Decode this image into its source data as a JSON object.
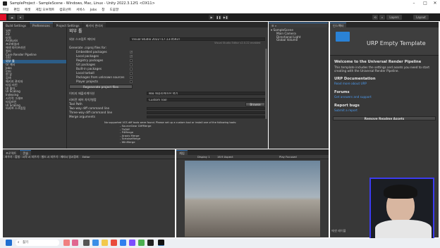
{
  "window": {
    "title": "SampleProject - SampleScene - Windows, Mac, Linux - Unity 2022.3.12f1 <DX11>",
    "controls": [
      "–",
      "□",
      "✕"
    ]
  },
  "menu": [
    "파일",
    "편집",
    "에셋",
    "게임 오브젝트",
    "컴포넌트",
    "서비스",
    "Jobs",
    "창",
    "도움말"
  ],
  "toolbar": {
    "layers_label": "Layers",
    "layout_label": "Layout"
  },
  "left_tabs": [
    "Build Settings",
    "Preferences",
    "Project Settings",
    "패키지 관리자"
  ],
  "sidebar": {
    "items": [
      {
        "label": "일반",
        "selected": false
      },
      {
        "label": "2D",
        "selected": false
      },
      {
        "label": "  타일",
        "selected": false
      },
      {
        "label": "Analysis",
        "selected": false
      },
      {
        "label": "  프로파일러",
        "selected": false
      },
      {
        "label": "에셋 파이프라인",
        "selected": false
      },
      {
        "label": "컬러",
        "selected": false
      },
      {
        "label": "Core Render Pipeline",
        "selected": false
      },
      {
        "label": "진단",
        "selected": false
      },
      {
        "label": "외부 툴",
        "selected": true
      },
      {
        "label": "GI 캐시",
        "selected": false
      },
      {
        "label": "Jobs",
        "selected": false
      },
      {
        "label": "언어",
        "selected": false
      },
      {
        "label": "씬 뷰",
        "selected": false
      },
      {
        "label": "검색",
        "selected": false
      },
      {
        "label": "패키지 관리자",
        "selected": false
      },
      {
        "label": "타임 라인",
        "selected": false
      },
      {
        "label": "UI 빌더",
        "selected": false
      },
      {
        "label": "UI Scaling",
        "selected": false
      },
      {
        "label": "  Indexing",
        "selected": false
      },
      {
        "label": "시각적 그래프",
        "selected": false
      },
      {
        "label": "타임라인",
        "selected": false
      },
      {
        "label": "UI Scaling",
        "selected": false
      },
      {
        "label": "씨샤프 스크립팅",
        "selected": false
      }
    ]
  },
  "prefs": {
    "heading": "외부 툴",
    "script_editor_label": "외부 스크립트 에디터",
    "script_editor_value": "Visual Studio 2022 [17.13.0593]",
    "version_note": "Visual Studio Editor v2.0.22 enabled",
    "generate_label": "Generate .csproj files for:",
    "options": [
      {
        "label": "Embedded packages",
        "checked": true
      },
      {
        "label": "Local packages",
        "checked": true
      },
      {
        "label": "Registry packages",
        "checked": false
      },
      {
        "label": "Git packages",
        "checked": false
      },
      {
        "label": "Built-in packages",
        "checked": false
      },
      {
        "label": "Local tarball",
        "checked": false
      },
      {
        "label": "Packages from unknown sources",
        "checked": false
      },
      {
        "label": "Player projects",
        "checked": false
      }
    ],
    "regen_button": "Regenerate project files",
    "image_app_label": "이미지 애플리케이션",
    "image_app_value": "배울 애플리케이션 열기",
    "revision_label": "리비전 제어 차이/병합",
    "revision_value": "Custom Tool",
    "tool_path_label": "Tool Path",
    "browse_button": "Browse",
    "two_way_label": "Two-way diff command line",
    "three_way_label": "Three-way diff command line",
    "merge_label": "Merge arguments",
    "vcs_note": "No supported VCS diff tools were found. Please set up a custom tool or install one of the following tools:",
    "tools": [
      "- SourceGear DiffMerge",
      "- TkDiff",
      "- P4Merge",
      "- Araxis Merge",
      "- TortoiseMerge",
      "- WinMerge"
    ]
  },
  "hierarchy": {
    "scene": "SampleScene",
    "items": [
      "Main Camera",
      "Directional Light",
      "Global Volume"
    ]
  },
  "project_panel": {
    "tabs": [
      "프로젝트",
      "콘솔"
    ],
    "toolbar": "지우기 · 합침 · 시작 시 지우기 · 빌드 시 지우기 · 에러시 일시정지",
    "editor_label": "Editor"
  },
  "game_panel": {
    "tab": "게임",
    "display": "Display 1",
    "aspect": "16:9 Aspect",
    "play_mode": "Play Focused"
  },
  "inspector": {
    "tab": "인스펙터",
    "template_title": "URP Empty Template",
    "welcome": "Welcome to the Universal Render Pipeline",
    "welcome_body": "This template includes the settings and assets you need to start creating with the Universal Render Pipeline.",
    "doc_heading": "URP Documentation",
    "doc_link": "Read more about URP",
    "forums_heading": "Forums",
    "forums_link": "Get answers and support",
    "bugs_heading": "Report bugs",
    "bugs_link": "Submit a report",
    "remove_button": "Remove Readme Assets",
    "footer": "에셋 레이블"
  },
  "taskbar": {
    "search_label": "찾기"
  },
  "colors": {
    "accent": "#3a79bb",
    "selection": "#2c5d87",
    "link": "#4c9bf0",
    "record_box": "#e0102a",
    "webcam_border": "#3b3bf0"
  }
}
